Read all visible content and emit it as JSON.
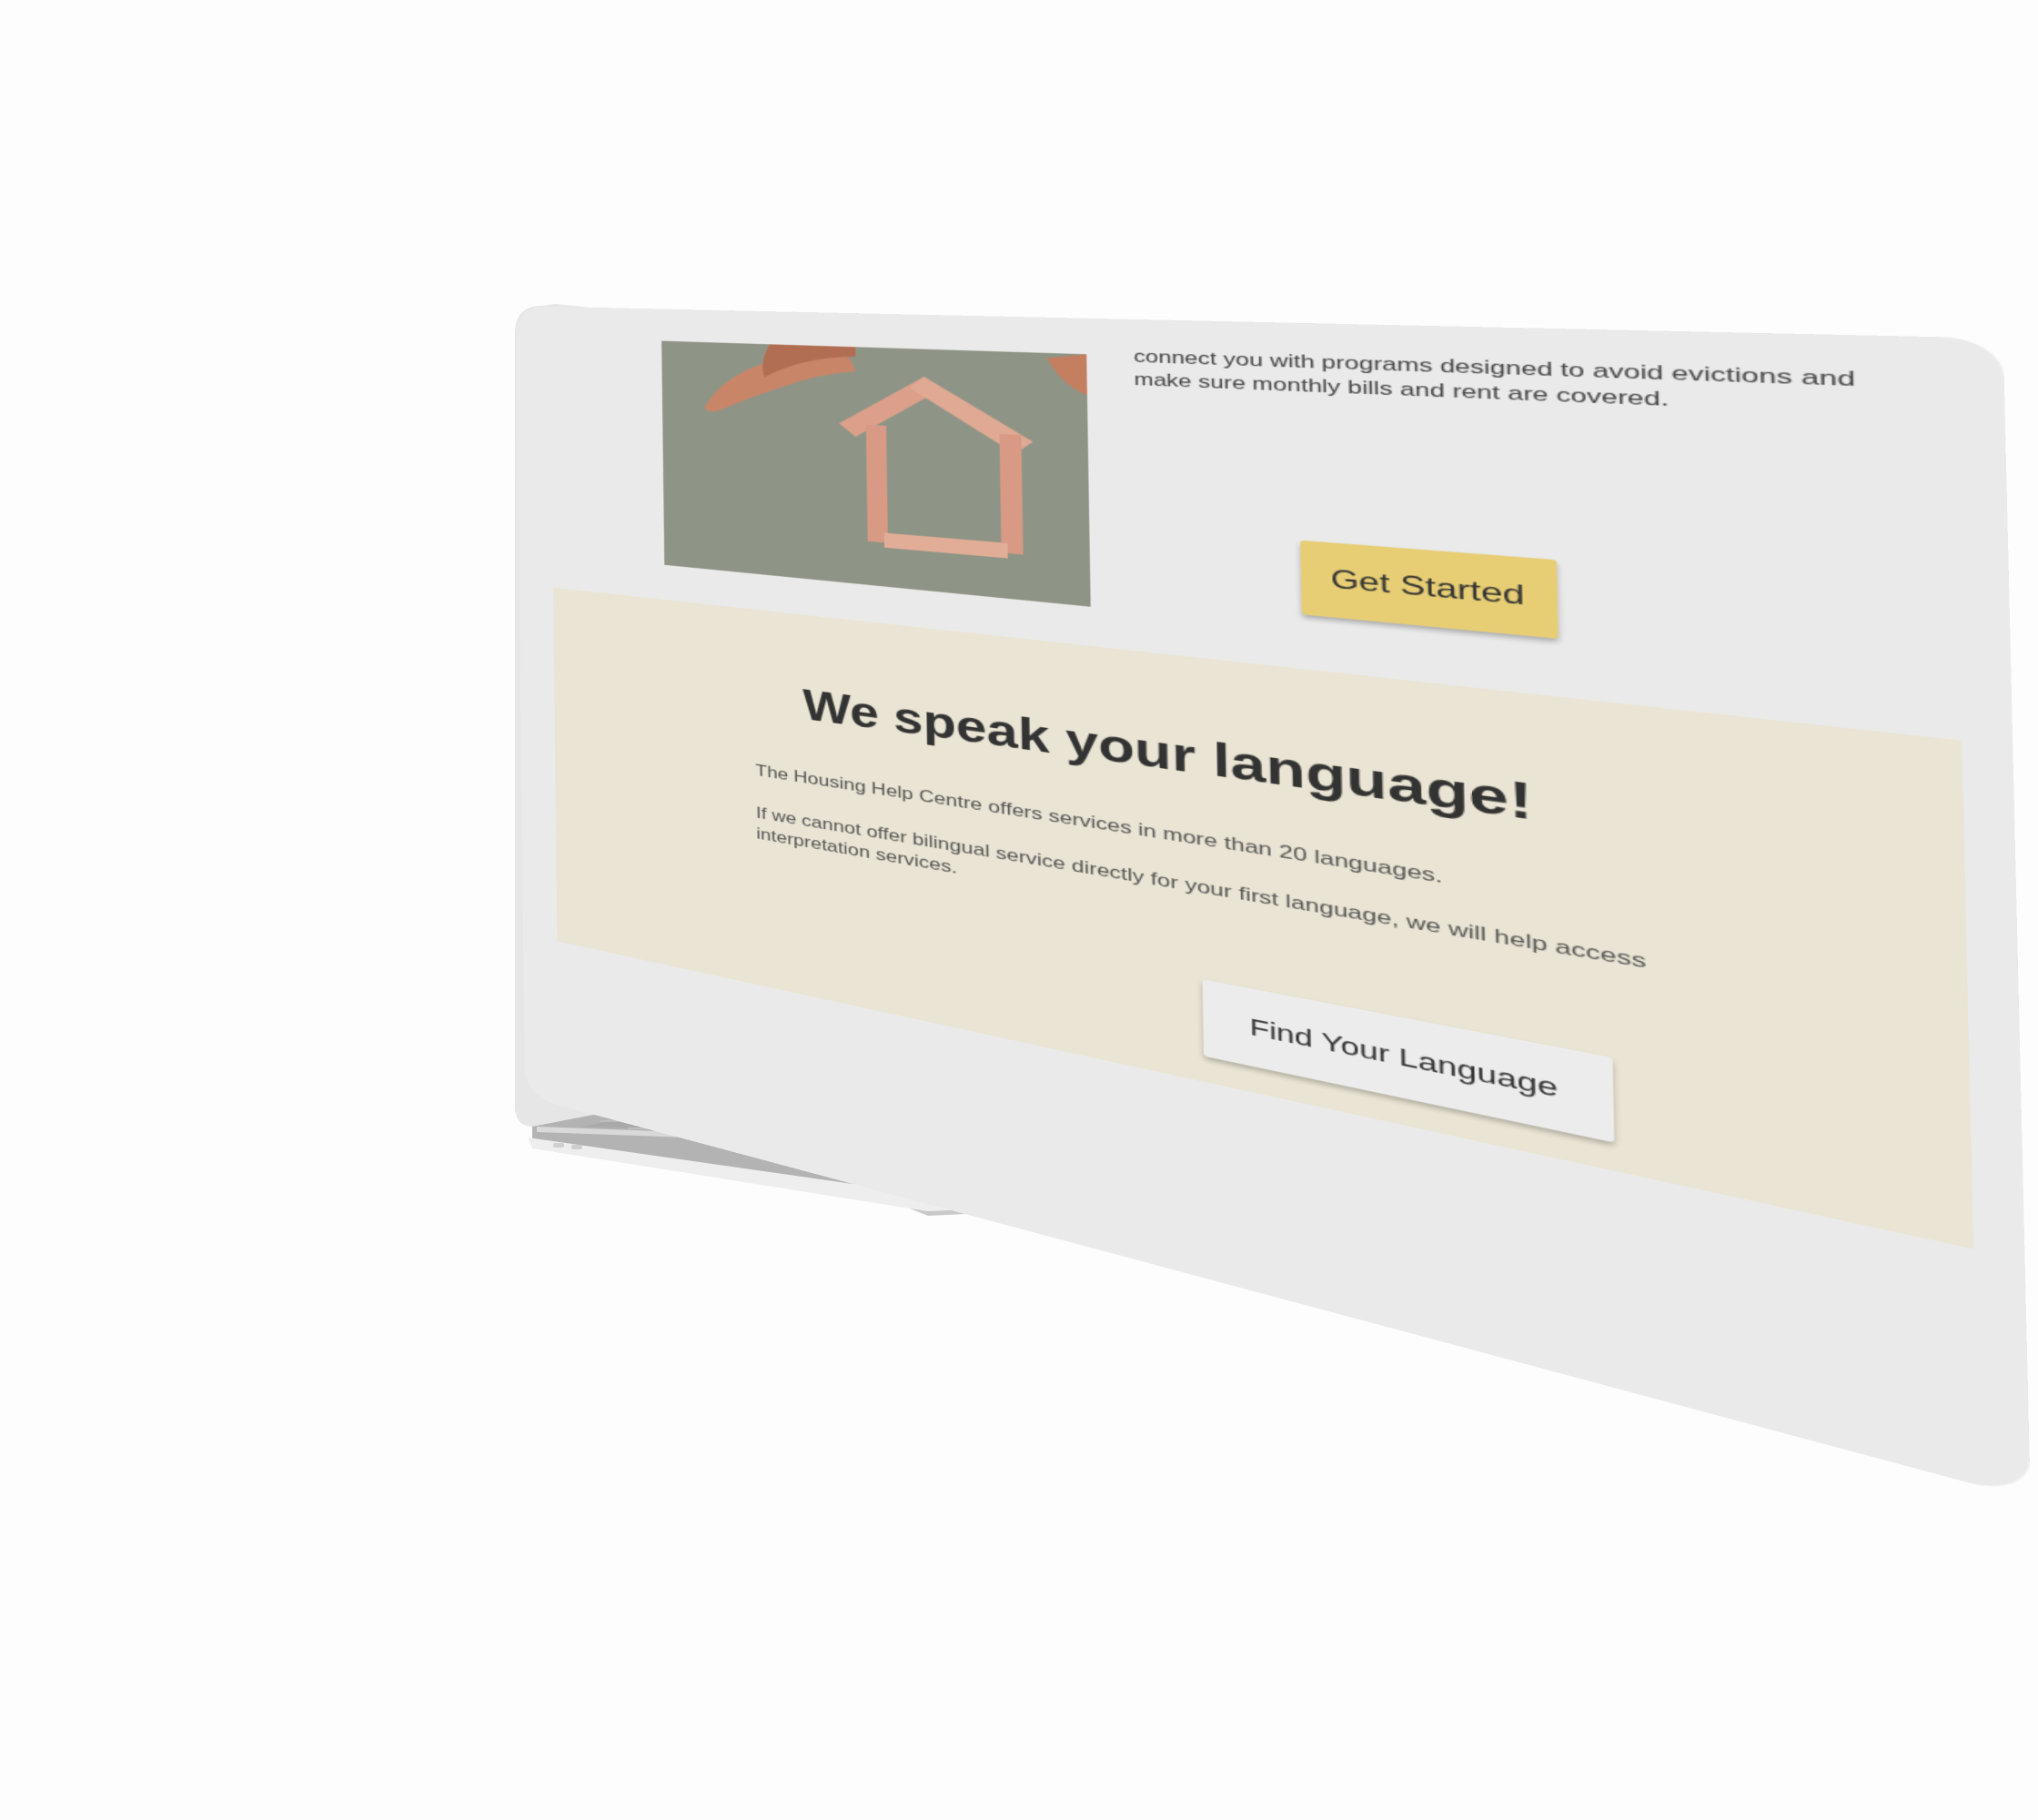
{
  "intro": {
    "text": "connect you with programs designed to avoid evictions and make sure monthly bills and rent are covered.",
    "image_alt": "wooden-block-house-icon",
    "button_label": "Get Started"
  },
  "language_section": {
    "title": "We speak your language!",
    "paragraph1": "The Housing Help Centre offers services in more than 20 languages.",
    "paragraph2": "If we cannot offer bilingual service directly for your first language, we will help access interpretation services.",
    "button_label": "Find Your Language"
  },
  "colors": {
    "page_background": "#eaeaea",
    "primary_button": "#e7cd74",
    "section_background": "#e9e4d3",
    "secondary_button": "#ececec",
    "text": "#333333"
  }
}
